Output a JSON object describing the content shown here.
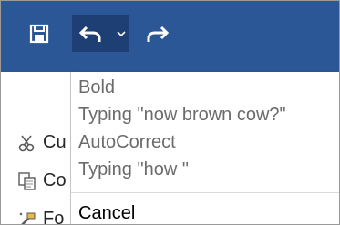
{
  "quick_access": {
    "save_icon": "save-icon",
    "undo_icon": "undo-icon",
    "undo_dropdown_icon": "chevron-down-icon",
    "redo_icon": "redo-icon",
    "titlebar_color": "#2b5797",
    "pressed_color": "#1e3f73"
  },
  "ribbon_hints": {
    "cut_label": "Cu",
    "copy_label": "Co",
    "format_label": "Fo"
  },
  "undo_list": {
    "items": [
      "Bold",
      "Typing \"now brown cow?\"",
      "AutoCorrect",
      "Typing \"how \""
    ],
    "cancel_label": "Cancel"
  }
}
